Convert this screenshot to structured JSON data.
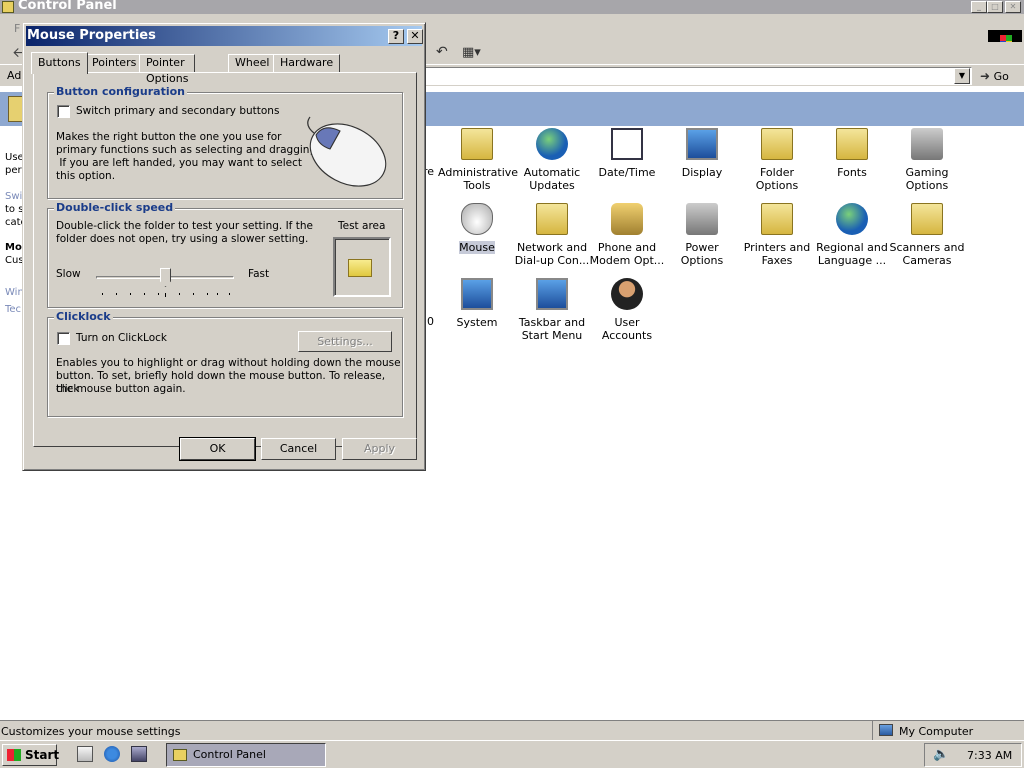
{
  "control_panel": {
    "title": "Control Panel",
    "menu_first": "F",
    "address_label": "Add",
    "go_label": "Go",
    "left_pane": [
      "Use",
      "per",
      "Swi",
      "to s",
      "cate",
      "Mo",
      "Cus",
      "Win",
      "Tec"
    ],
    "items": [
      {
        "label": "re",
        "icon": "partial-item-icon"
      },
      {
        "label": "Administrative Tools",
        "icon": "administrative-tools-icon"
      },
      {
        "label": "Automatic Updates",
        "icon": "automatic-updates-icon"
      },
      {
        "label": "Date/Time",
        "icon": "date-time-icon"
      },
      {
        "label": "Display",
        "icon": "display-icon"
      },
      {
        "label": "Folder Options",
        "icon": "folder-options-icon"
      },
      {
        "label": "Fonts",
        "icon": "fonts-icon"
      },
      {
        "label": "Gaming Options",
        "icon": "gaming-options-icon"
      },
      {
        "label": "Mouse",
        "icon": "mouse-icon"
      },
      {
        "label": "Network and Dial-up Con...",
        "icon": "network-icon"
      },
      {
        "label": "Phone and Modem Opt...",
        "icon": "phone-modem-icon"
      },
      {
        "label": "Power Options",
        "icon": "power-options-icon"
      },
      {
        "label": "Printers and Faxes",
        "icon": "printers-faxes-icon"
      },
      {
        "label": "Regional and Language ...",
        "icon": "regional-icon"
      },
      {
        "label": "Scanners and Cameras",
        "icon": "scanners-icon"
      },
      {
        "label": "0",
        "icon": "partial-item-icon"
      },
      {
        "label": "System",
        "icon": "system-icon"
      },
      {
        "label": "Taskbar and Start Menu",
        "icon": "taskbar-icon"
      },
      {
        "label": "User Accounts",
        "icon": "user-accounts-icon"
      }
    ],
    "status_text": "Customizes your mouse settings",
    "zone_text": "My Computer"
  },
  "taskbar": {
    "start_label": "Start",
    "task_label": "Control Panel",
    "clock": "7:33 AM"
  },
  "dialog": {
    "title": "Mouse Properties",
    "help_label": "?",
    "close_label": "✕",
    "tabs": [
      "Buttons",
      "Pointers",
      "Pointer Options",
      "Wheel",
      "Hardware"
    ],
    "active_tab": "Buttons",
    "button_config": {
      "legend": "Button configuration",
      "checkbox_label": "Switch primary and secondary buttons",
      "checked": false,
      "desc_lines": [
        "Makes the right button the one you use for",
        "primary functions such as selecting and dragging.",
        " If you are left handed, you may want to select",
        "this option."
      ]
    },
    "double_click": {
      "legend": "Double-click speed",
      "desc_lines": [
        "Double-click the folder to test your setting.  If the",
        "folder does not open, try using a slower setting."
      ],
      "test_area_label": "Test area",
      "slow_label": "Slow",
      "fast_label": "Fast",
      "slider_position": 0.5
    },
    "clicklock": {
      "legend": "Clicklock",
      "checkbox_label": "Turn on ClickLock",
      "checked": false,
      "settings_label": "Settings...",
      "desc_lines": [
        "Enables you to highlight or drag without holding down the mouse",
        "button.  To set, briefly hold down the mouse button.  To release, click",
        "the mouse button again."
      ]
    },
    "buttons": {
      "ok": "OK",
      "cancel": "Cancel",
      "apply": "Apply"
    }
  }
}
